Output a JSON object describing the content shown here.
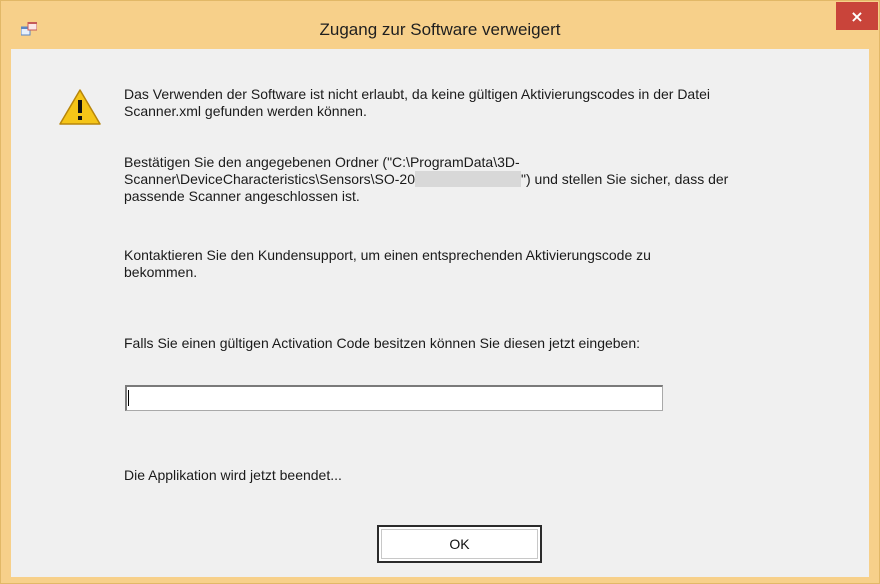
{
  "window": {
    "title": "Zugang zur Software verweigert",
    "app_icon": "app-window-icon",
    "close_label": "×",
    "close_icon": "close-icon",
    "colors": {
      "frame": "#f7d08a",
      "close_bg": "#c9443a",
      "client_bg": "#f0f0f0"
    }
  },
  "dialog": {
    "warning_icon": "warning-icon",
    "message_1": "Das Verwenden der Software ist nicht erlaubt, da keine gültigen Aktivierungscodes in der Datei\nScanner.xml gefunden werden können.",
    "message_2_before": "Bestätigen Sie den angegebenen Ordner (\"C:\\ProgramData\\3D-\nScanner\\DeviceCharacteristics\\Sensors\\SO-20",
    "message_2_after": "\") und stellen Sie sicher, dass der\npassende Scanner angeschlossen ist.",
    "message_3": "Kontaktieren Sie den Kundensupport, um einen entsprechenden Aktivierungscode zu\nbekommen.",
    "prompt": "Falls Sie einen gültigen Activation Code besitzen können Sie diesen jetzt eingeben:",
    "activation_code_value": "",
    "exit_notice": "Die Applikation wird jetzt beendet...",
    "ok_label": "OK"
  }
}
